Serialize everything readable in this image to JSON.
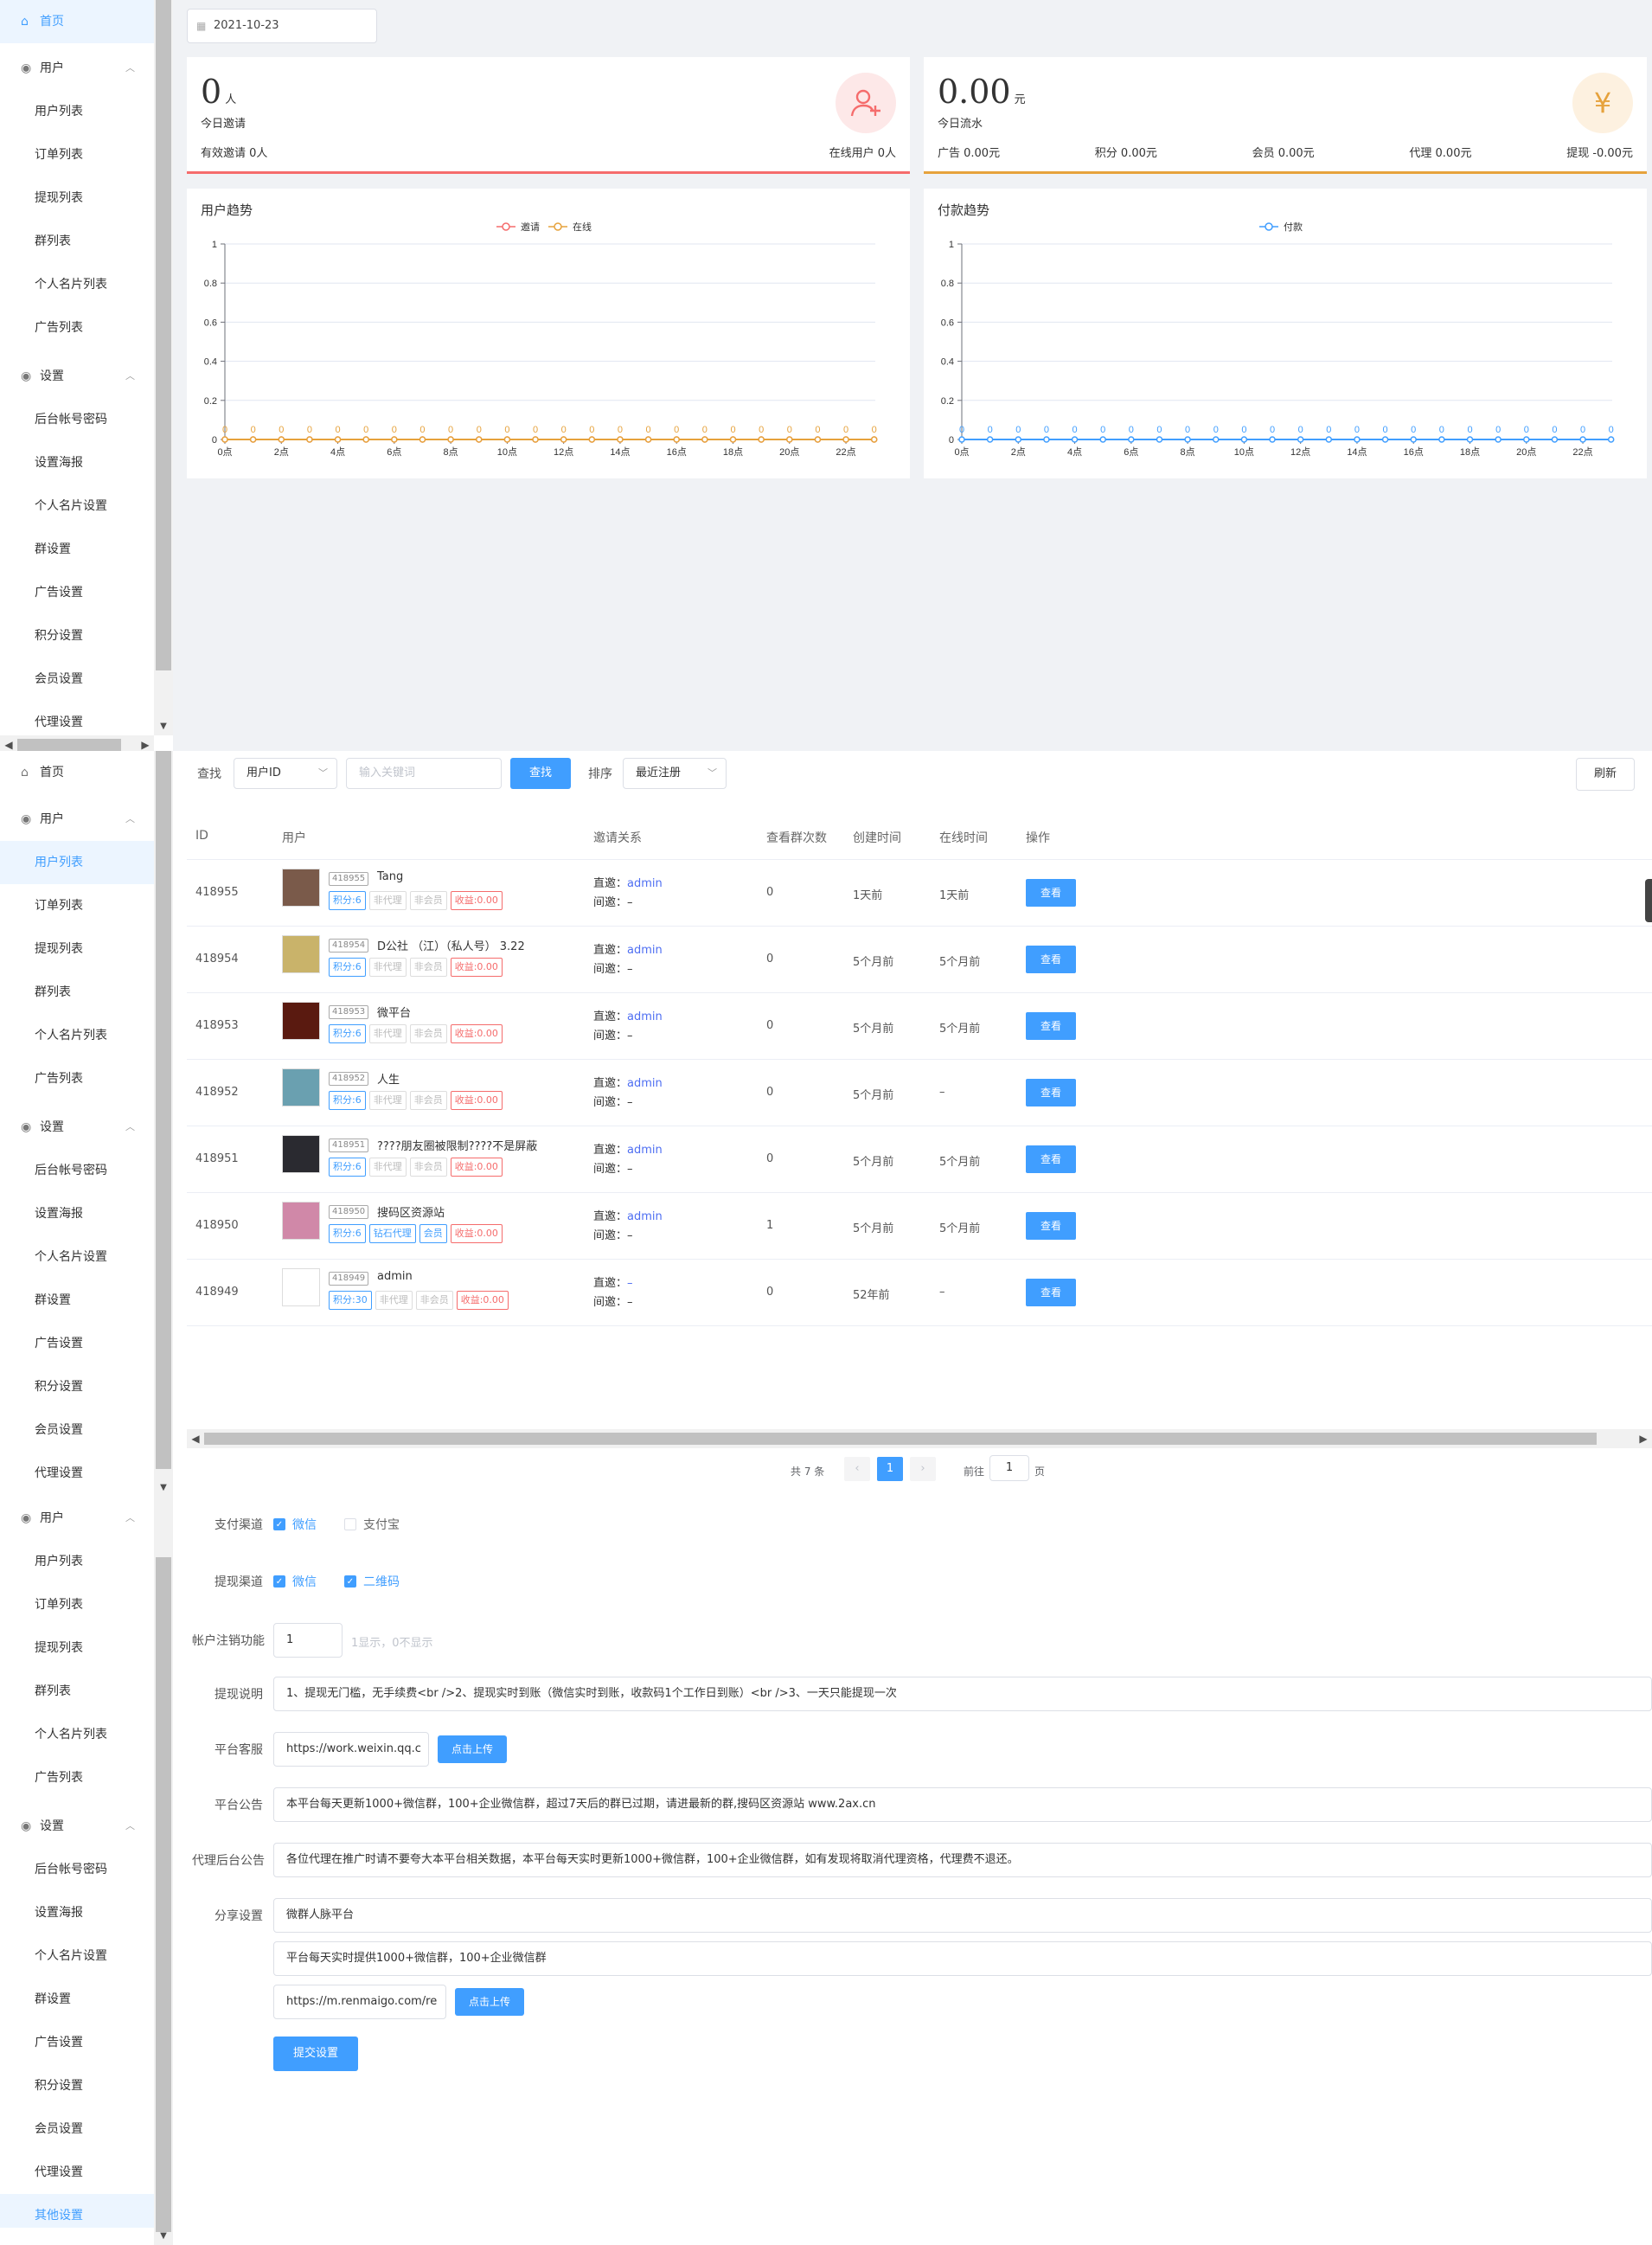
{
  "sidebar1": {
    "home": "首页",
    "users_group": "用户",
    "users_items": [
      "用户列表",
      "订单列表",
      "提现列表",
      "群列表",
      "个人名片列表",
      "广告列表"
    ],
    "settings_group": "设置",
    "settings_items": [
      "后台帐号密码",
      "设置海报",
      "个人名片设置",
      "群设置",
      "广告设置",
      "积分设置",
      "会员设置",
      "代理设置"
    ]
  },
  "sidebar3": {
    "users_group": "用户",
    "users_items": [
      "用户列表",
      "订单列表",
      "提现列表",
      "群列表",
      "个人名片列表",
      "广告列表"
    ],
    "settings_group": "设置",
    "settings_items": [
      "后台帐号密码",
      "设置海报",
      "个人名片设置",
      "群设置",
      "广告设置",
      "积分设置",
      "会员设置",
      "代理设置",
      "其他设置"
    ]
  },
  "dashboard": {
    "date": "2021-10-23",
    "invite_card": {
      "value": "0",
      "unit": "人",
      "label": "今日邀请",
      "left_stat": "有效邀请 0人",
      "right_stat": "在线用户 0人",
      "icon": "user-plus-icon",
      "accent": "#f56c6c"
    },
    "flow_card": {
      "value": "0.00",
      "unit": "元",
      "label": "今日流水",
      "stats": [
        "广告 0.00元",
        "积分 0.00元",
        "会员 0.00元",
        "代理 0.00元",
        "提现 -0.00元"
      ],
      "icon": "yuan-icon",
      "accent": "#e6a23c"
    }
  },
  "chart_data": [
    {
      "type": "line",
      "title": "用户趋势",
      "x": [
        "0点",
        "1点",
        "2点",
        "3点",
        "4点",
        "5点",
        "6点",
        "7点",
        "8点",
        "9点",
        "10点",
        "11点",
        "12点",
        "13点",
        "14点",
        "15点",
        "16点",
        "17点",
        "18点",
        "19点",
        "20点",
        "21点",
        "22点",
        "23点"
      ],
      "x_tick_labels": [
        "0点",
        "2点",
        "4点",
        "6点",
        "8点",
        "10点",
        "12点",
        "14点",
        "16点",
        "18点",
        "20点",
        "22点"
      ],
      "y_ticks": [
        "0",
        "0.2",
        "0.4",
        "0.6",
        "0.8",
        "1"
      ],
      "ylim": [
        0,
        1
      ],
      "grid": true,
      "legend": "top-center",
      "series": [
        {
          "name": "邀请",
          "color": "#f56c6c",
          "values": [
            0,
            0,
            0,
            0,
            0,
            0,
            0,
            0,
            0,
            0,
            0,
            0,
            0,
            0,
            0,
            0,
            0,
            0,
            0,
            0,
            0,
            0,
            0,
            0
          ]
        },
        {
          "name": "在线",
          "color": "#e6a23c",
          "values": [
            0,
            0,
            0,
            0,
            0,
            0,
            0,
            0,
            0,
            0,
            0,
            0,
            0,
            0,
            0,
            0,
            0,
            0,
            0,
            0,
            0,
            0,
            0,
            0
          ]
        }
      ],
      "point_labels": [
        "0",
        "0",
        "0",
        "0",
        "0",
        "0",
        "0",
        "0",
        "0",
        "0",
        "0",
        "0",
        "0",
        "0",
        "0",
        "0",
        "0",
        "0",
        "0",
        "0",
        "0",
        "0",
        "0",
        "0"
      ]
    },
    {
      "type": "line",
      "title": "付款趋势",
      "x": [
        "0点",
        "1点",
        "2点",
        "3点",
        "4点",
        "5点",
        "6点",
        "7点",
        "8点",
        "9点",
        "10点",
        "11点",
        "12点",
        "13点",
        "14点",
        "15点",
        "16点",
        "17点",
        "18点",
        "19点",
        "20点",
        "21点",
        "22点",
        "23点"
      ],
      "x_tick_labels": [
        "0点",
        "2点",
        "4点",
        "6点",
        "8点",
        "10点",
        "12点",
        "14点",
        "16点",
        "18点",
        "20点",
        "22点"
      ],
      "y_ticks": [
        "0",
        "0.2",
        "0.4",
        "0.6",
        "0.8",
        "1"
      ],
      "ylim": [
        0,
        1
      ],
      "grid": true,
      "legend": "top-center",
      "series": [
        {
          "name": "付款",
          "color": "#409eff",
          "values": [
            0,
            0,
            0,
            0,
            0,
            0,
            0,
            0,
            0,
            0,
            0,
            0,
            0,
            0,
            0,
            0,
            0,
            0,
            0,
            0,
            0,
            0,
            0,
            0
          ]
        }
      ],
      "point_labels": [
        "0",
        "0",
        "0",
        "0",
        "0",
        "0",
        "0",
        "0",
        "0",
        "0",
        "0",
        "0",
        "0",
        "0",
        "0",
        "0",
        "0",
        "0",
        "0",
        "0",
        "0",
        "0",
        "0",
        "0"
      ]
    }
  ],
  "userlist": {
    "search_label": "查找",
    "field_select": "用户ID",
    "keyword_placeholder": "输入关键词",
    "search_button": "查找",
    "sort_label": "排序",
    "sort_select": "最近注册",
    "refresh_button": "刷新",
    "columns": [
      "ID",
      "用户",
      "邀请关系",
      "查看群次数",
      "创建时间",
      "在线时间",
      "操作"
    ],
    "direct_label": "直邀：",
    "indirect_label": "间邀：",
    "view_button": "查看",
    "rows": [
      {
        "id": "418955",
        "uid": "418955",
        "name": "Tang",
        "tags": [
          {
            "t": "积分:6",
            "c": "b"
          },
          {
            "t": "非代理",
            "c": "g"
          },
          {
            "t": "非会员",
            "c": "g"
          },
          {
            "t": "收益:0.00",
            "c": "r"
          }
        ],
        "direct": "admin",
        "indirect": "–",
        "views": "0",
        "created": "1天前",
        "online": "1天前",
        "avatar": "#7a5a4a"
      },
      {
        "id": "418954",
        "uid": "418954",
        "name": "D公社 （江）（私人号） 3.22",
        "tags": [
          {
            "t": "积分:6",
            "c": "b"
          },
          {
            "t": "非代理",
            "c": "g"
          },
          {
            "t": "非会员",
            "c": "g"
          },
          {
            "t": "收益:0.00",
            "c": "r"
          }
        ],
        "direct": "admin",
        "indirect": "–",
        "views": "0",
        "created": "5个月前",
        "online": "5个月前",
        "avatar": "#c9b36a"
      },
      {
        "id": "418953",
        "uid": "418953",
        "name": "微平台",
        "tags": [
          {
            "t": "积分:6",
            "c": "b"
          },
          {
            "t": "非代理",
            "c": "g"
          },
          {
            "t": "非会员",
            "c": "g"
          },
          {
            "t": "收益:0.00",
            "c": "r"
          }
        ],
        "direct": "admin",
        "indirect": "–",
        "views": "0",
        "created": "5个月前",
        "online": "5个月前",
        "avatar": "#5a1a10"
      },
      {
        "id": "418952",
        "uid": "418952",
        "name": "人生",
        "tags": [
          {
            "t": "积分:6",
            "c": "b"
          },
          {
            "t": "非代理",
            "c": "g"
          },
          {
            "t": "非会员",
            "c": "g"
          },
          {
            "t": "收益:0.00",
            "c": "r"
          }
        ],
        "direct": "admin",
        "indirect": "–",
        "views": "0",
        "created": "5个月前",
        "online": "–",
        "avatar": "#6aa0b0"
      },
      {
        "id": "418951",
        "uid": "418951",
        "name": "????朋友圈被限制????不是屏蔽",
        "tags": [
          {
            "t": "积分:6",
            "c": "b"
          },
          {
            "t": "非代理",
            "c": "g"
          },
          {
            "t": "非会员",
            "c": "g"
          },
          {
            "t": "收益:0.00",
            "c": "r"
          }
        ],
        "direct": "admin",
        "indirect": "–",
        "views": "0",
        "created": "5个月前",
        "online": "5个月前",
        "avatar": "#2a2a30"
      },
      {
        "id": "418950",
        "uid": "418950",
        "name": "搜码区资源站",
        "tags": [
          {
            "t": "积分:6",
            "c": "b"
          },
          {
            "t": "钻石代理",
            "c": "b"
          },
          {
            "t": "会员",
            "c": "b"
          },
          {
            "t": "收益:0.00",
            "c": "r"
          }
        ],
        "direct": "admin",
        "indirect": "–",
        "views": "1",
        "created": "5个月前",
        "online": "5个月前",
        "avatar": "#d088a8"
      },
      {
        "id": "418949",
        "uid": "418949",
        "name": "admin",
        "tags": [
          {
            "t": "积分:30",
            "c": "b"
          },
          {
            "t": "非代理",
            "c": "g"
          },
          {
            "t": "非会员",
            "c": "g"
          },
          {
            "t": "收益:0.00",
            "c": "r"
          }
        ],
        "direct": "–",
        "indirect": "–",
        "views": "0",
        "created": "52年前",
        "online": "–",
        "avatar": "#ffffff"
      }
    ],
    "pagination": {
      "total_text": "共 7 条",
      "current_page": "1",
      "goto_label": "前往",
      "goto_value": "1",
      "page_suffix": "页",
      "prev": "‹",
      "next": "›"
    }
  },
  "settings_form": {
    "pay_channel_label": "支付渠道",
    "pay_channels": [
      {
        "label": "微信",
        "checked": true
      },
      {
        "label": "支付宝",
        "checked": false
      }
    ],
    "withdraw_channel_label": "提现渠道",
    "withdraw_channels": [
      {
        "label": "微信",
        "checked": true
      },
      {
        "label": "二维码",
        "checked": true
      }
    ],
    "account_cancel_label": "帐户注销功能",
    "account_cancel_value": "1",
    "account_cancel_hint": "1显示，0不显示",
    "withdraw_note_label": "提现说明",
    "withdraw_note_value": "1、提现无门槛，无手续费<br />2、提现实时到账（微信实时到账，收款码1个工作日到账）<br />3、一天只能提现一次",
    "service_label": "平台客服",
    "service_value": "https://work.weixin.qq.c",
    "upload_button": "点击上传",
    "notice_label": "平台公告",
    "notice_value": "本平台每天更新1000+微信群，100+企业微信群，超过7天后的群已过期，请进最新的群,搜码区资源站 www.2ax.cn",
    "agent_notice_label": "代理后台公告",
    "agent_notice_value": "各位代理在推广时请不要夸大本平台相关数据，本平台每天实时更新1000+微信群，100+企业微信群，如有发现将取消代理资格，代理费不退还。",
    "share_label": "分享设置",
    "share_title_value": "微群人脉平台",
    "share_desc_value": "平台每天实时提供1000+微信群，100+企业微信群",
    "share_image_value": "https://m.renmaigo.com/re",
    "submit_button": "提交设置"
  }
}
